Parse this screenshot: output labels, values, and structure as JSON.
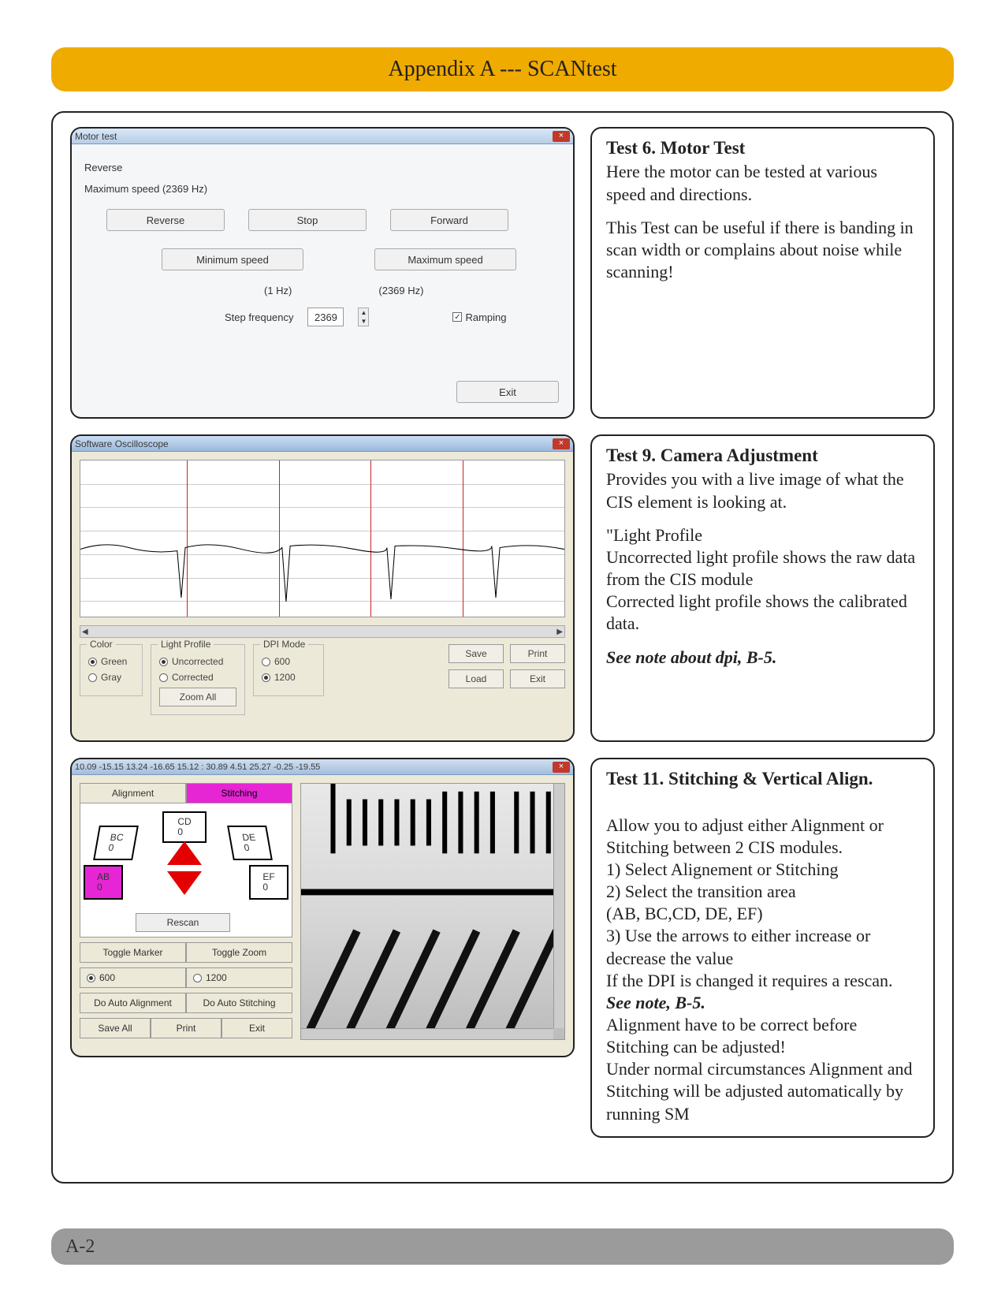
{
  "header": {
    "title": "Appendix A --- SCANtest"
  },
  "footer": {
    "page": "A-2"
  },
  "test6": {
    "title": "Test 6. Motor Test",
    "p1": "Here the motor can be tested at various speed and directions.",
    "p2": "This Test can be useful if there is banding in scan width or complains about noise while scanning!",
    "window_title": "Motor test",
    "close": "×",
    "label_reverse": "Reverse",
    "label_max": "Maximum speed (2369 Hz)",
    "btn_reverse": "Reverse",
    "btn_stop": "Stop",
    "btn_forward": "Forward",
    "btn_min": "Minimum speed",
    "btn_max": "Maximum speed",
    "lbl_1hz": "(1 Hz)",
    "lbl_2369hz": "(2369 Hz)",
    "lbl_stepfreq": "Step frequency",
    "val_stepfreq": "2369",
    "chk_ramp": "Ramping",
    "btn_exit": "Exit"
  },
  "test9": {
    "title": "Test 9. Camera Adjustment",
    "p1": "Provides you with a live image of what the CIS element is looking at.",
    "p2": "\"Light Profile\nUncorrected light profile shows the raw data from the CIS module\nCorrected light profile shows the calibrated data.",
    "note": "See note about dpi, B-5.",
    "window_title": "Software Oscilloscope",
    "close": "×",
    "group_color": "Color",
    "group_light": "Light Profile",
    "group_dpi": "DPI Mode",
    "r_green": "Green",
    "r_gray": "Gray",
    "r_uncorr": "Uncorrected",
    "r_corr": "Corrected",
    "r_600": "600",
    "r_1200": "1200",
    "btn_zoom": "Zoom All",
    "btn_save": "Save",
    "btn_print": "Print",
    "btn_load": "Load",
    "btn_exit": "Exit"
  },
  "test11": {
    "title": "Test 11. Stitching & Vertical Align.",
    "body": "Allow you to adjust either Alignment or Stitching between 2 CIS modules.\n1) Select Alignement or Stitching\n2) Select the transition area\n          (AB, BC,CD, DE, EF)\n3) Use the arrows to either increase or\n          decrease the value\nIf the DPI is changed it requires a rescan. ",
    "note": "See note, B-5.",
    "body2": "\nAlignment have to be correct before Stitching can be adjusted!\nUnder normal circumstances Alignment and Stitching will be adjusted automatically by running SM",
    "window_title": "10.09 -15.15 13.24 -16.65 15.12 : 30.89  4.51 25.27 -0.25 -19.55",
    "close": "×",
    "tab_align": "Alignment",
    "tab_stitch": "Stitching",
    "cell_ab": "AB\n0",
    "cell_bc": "BC\n0",
    "cell_cd": "CD\n0",
    "cell_de": "DE\n0",
    "cell_ef": "EF\n0",
    "btn_rescan": "Rescan",
    "btn_toggle_marker": "Toggle Marker",
    "btn_toggle_zoom": "Toggle Zoom",
    "r_600": "600",
    "r_1200": "1200",
    "btn_auto_align": "Do Auto Alignment",
    "btn_auto_stitch": "Do Auto Stitching",
    "btn_save_all": "Save All",
    "btn_print": "Print",
    "btn_exit": "Exit"
  }
}
